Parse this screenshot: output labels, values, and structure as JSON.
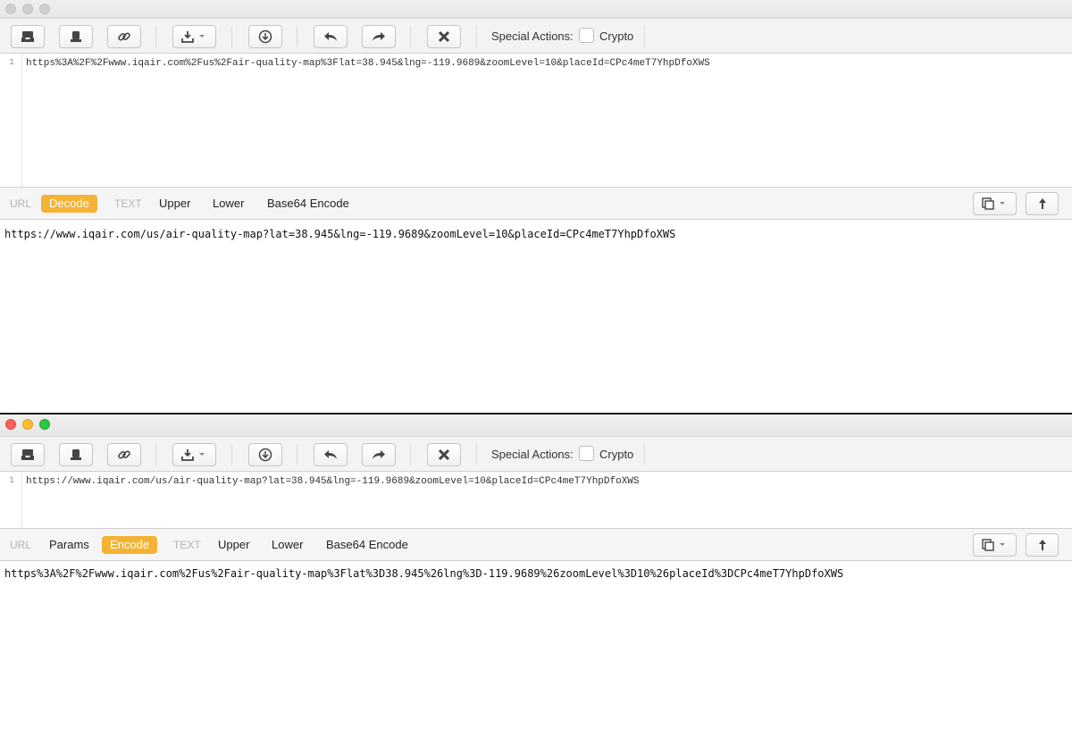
{
  "windows": [
    {
      "toolbar": {
        "special_actions_label": "Special Actions:",
        "crypto_label": "Crypto",
        "crypto_checked": false
      },
      "input": {
        "line_number": "1",
        "text": "https%3A%2F%2Fwww.iqair.com%2Fus%2Fair-quality-map%3Flat=38.945&lng=-119.9689&zoomLevel=10&placeId=CPc4meT7YhpDfoXWS"
      },
      "modes": {
        "url": "URL",
        "decode": "Decode",
        "text": "TEXT",
        "upper": "Upper",
        "lower": "Lower",
        "base64_encode": "Base64 Encode"
      },
      "output": {
        "text": "https://www.iqair.com/us/air-quality-map?lat=38.945&lng=-119.9689&zoomLevel=10&placeId=CPc4meT7YhpDfoXWS"
      }
    },
    {
      "toolbar": {
        "special_actions_label": "Special Actions:",
        "crypto_label": "Crypto",
        "crypto_checked": false
      },
      "input": {
        "line_number": "1",
        "text": "https://www.iqair.com/us/air-quality-map?lat=38.945&lng=-119.9689&zoomLevel=10&placeId=CPc4meT7YhpDfoXWS"
      },
      "modes": {
        "url": "URL",
        "params": "Params",
        "encode": "Encode",
        "text": "TEXT",
        "upper": "Upper",
        "lower": "Lower",
        "base64_encode": "Base64 Encode"
      },
      "output": {
        "text": "https%3A%2F%2Fwww.iqair.com%2Fus%2Fair-quality-map%3Flat%3D38.945%26lng%3D-119.9689%26zoomLevel%3D10%26placeId%3DCPc4meT7YhpDfoXWS"
      }
    }
  ],
  "colors": {
    "active_mode": "#f5b335",
    "traffic_red": "#fc5f57",
    "traffic_yellow": "#fdbc2e",
    "traffic_green": "#28c840"
  },
  "icons": {
    "toolbar": [
      "inbox-tray-icon",
      "stamp-icon",
      "link-icon",
      "download-menu-icon",
      "download-circle-icon",
      "undo-arrow-icon",
      "redo-arrow-icon",
      "clear-x-icon"
    ],
    "modebar_right": [
      "copy-menu-icon",
      "promote-up-arrow-icon"
    ]
  }
}
